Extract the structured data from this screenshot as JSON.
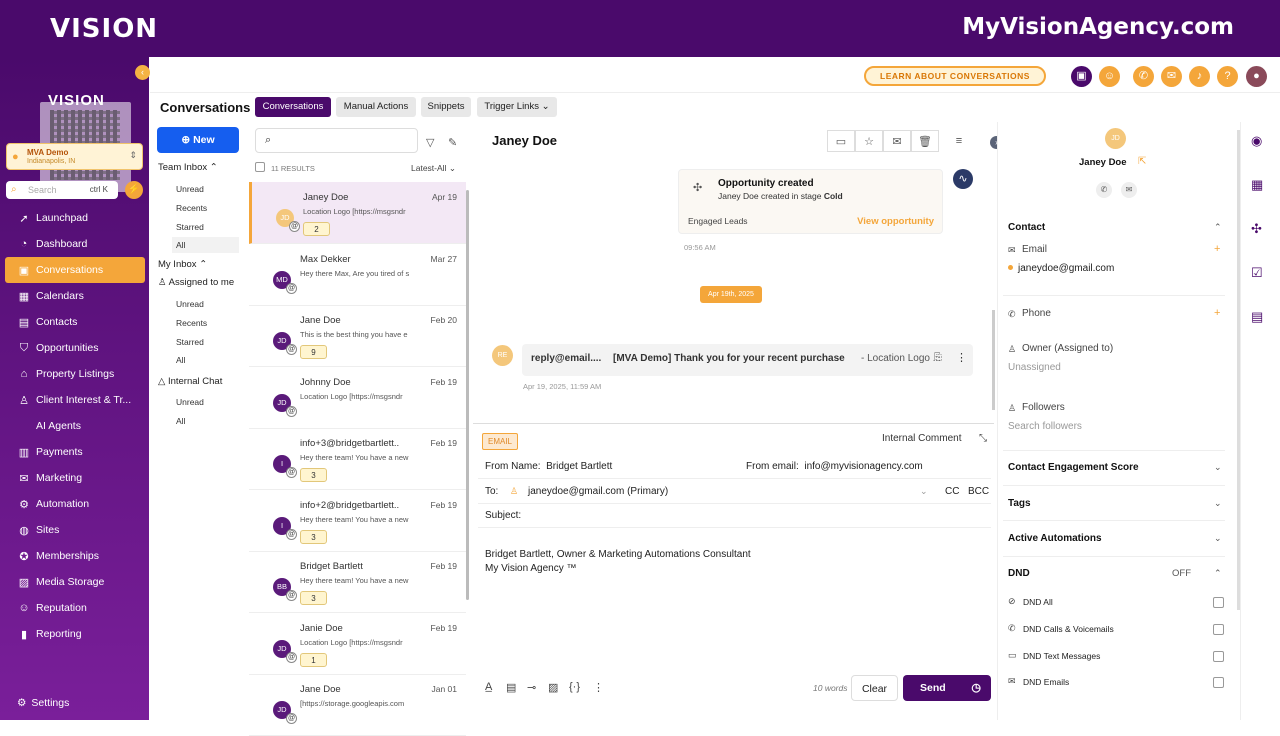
{
  "brand": {
    "left": "VISION",
    "right": "MyVisionAgency.com",
    "qr_text": "VISION"
  },
  "location": {
    "name": "MVA Demo",
    "sub": "Indianapolis, IN"
  },
  "sidebar_search": {
    "placeholder": "Search",
    "shortcut": "ctrl K"
  },
  "nav": [
    {
      "label": "Launchpad",
      "icon": "rocket-icon"
    },
    {
      "label": "Dashboard",
      "icon": "dashboard-icon"
    },
    {
      "label": "Conversations",
      "icon": "chat-icon",
      "active": true
    },
    {
      "label": "Calendars",
      "icon": "calendar-icon"
    },
    {
      "label": "Contacts",
      "icon": "contacts-icon"
    },
    {
      "label": "Opportunities",
      "icon": "funnel-icon"
    },
    {
      "label": "Property Listings",
      "icon": "house-icon"
    },
    {
      "label": "Client Interest & Tr...",
      "icon": "person-icon"
    },
    {
      "label": "AI Agents",
      "icon": ""
    },
    {
      "label": "Payments",
      "icon": "payments-icon"
    },
    {
      "label": "Marketing",
      "icon": "megaphone-icon"
    },
    {
      "label": "Automation",
      "icon": "automation-icon"
    },
    {
      "label": "Sites",
      "icon": "globe-icon"
    },
    {
      "label": "Memberships",
      "icon": "memberships-icon"
    },
    {
      "label": "Media Storage",
      "icon": "image-icon"
    },
    {
      "label": "Reputation",
      "icon": "reputation-icon"
    },
    {
      "label": "Reporting",
      "icon": "bar-chart-icon"
    }
  ],
  "settings_label": "Settings",
  "header": {
    "learn_label": "LEARN ABOUT CONVERSATIONS",
    "title": "Conversations",
    "tabs": [
      "Conversations",
      "Manual Actions",
      "Snippets",
      "Trigger Links"
    ]
  },
  "left_panel": {
    "new_label": "New",
    "team_inbox": "Team Inbox",
    "team_items": [
      "Unread",
      "Recents",
      "Starred",
      "All"
    ],
    "my_inbox": "My Inbox",
    "assigned": "Assigned to me",
    "my_items": [
      "Unread",
      "Recents",
      "Starred",
      "All"
    ],
    "internal_chat": "Internal Chat",
    "chat_items": [
      "Unread",
      "All"
    ]
  },
  "list": {
    "results": "11 RESULTS",
    "sort": "Latest-All",
    "rows": [
      {
        "initials": "JD",
        "name": "Janey Doe",
        "date": "Apr 19",
        "preview": "Location Logo [https://msgsndr",
        "badge": "2",
        "color": "#f4c77b"
      },
      {
        "initials": "MD",
        "name": "Max Dekker",
        "date": "Mar 27",
        "preview": "Hey there Max, Are you tired of s",
        "badge": "",
        "color": "#5a1a7a"
      },
      {
        "initials": "JD",
        "name": "Jane Doe",
        "date": "Feb 20",
        "preview": "This is the best thing you have e",
        "badge": "9",
        "color": "#5a1a7a"
      },
      {
        "initials": "JD",
        "name": "Johnny Doe",
        "date": "Feb 19",
        "preview": "Location Logo [https://msgsndr",
        "badge": "",
        "color": "#5a1a7a"
      },
      {
        "initials": "I",
        "name": "info+3@bridgetbartlett..",
        "date": "Feb 19",
        "preview": "Hey there team! You have a new",
        "badge": "3",
        "color": "#5a1a7a"
      },
      {
        "initials": "I",
        "name": "info+2@bridgetbartlett..",
        "date": "Feb 19",
        "preview": "Hey there team! You have a new",
        "badge": "3",
        "color": "#5a1a7a"
      },
      {
        "initials": "BB",
        "name": "Bridget Bartlett",
        "date": "Feb 19",
        "preview": "Hey there team! You have a new",
        "badge": "3",
        "color": "#5a1a7a"
      },
      {
        "initials": "JD",
        "name": "Janie Doe",
        "date": "Feb 19",
        "preview": "Location Logo [https://msgsndr",
        "badge": "1",
        "color": "#5a1a7a"
      },
      {
        "initials": "JD",
        "name": "Jane Doe",
        "date": "Jan 01",
        "preview": "[https://storage.googleapis.com",
        "badge": "",
        "color": "#5a1a7a"
      }
    ]
  },
  "conversation": {
    "name": "Janey Doe",
    "opp_title": "Opportunity created",
    "opp_sub_prefix": "Janey Doe created in stage ",
    "opp_stage": "Cold",
    "opp_lead": "Engaged Leads",
    "opp_link": "View opportunity",
    "time1": "09:56 AM",
    "date_pill": "Apr 19th, 2025",
    "email_avatar": "RE",
    "email_from": "reply@email....",
    "email_subject": "[MVA Demo] Thank you for your recent purchase",
    "email_snippet": "-  Location Logo ...",
    "time2": "Apr 19, 2025, 11:59 AM"
  },
  "composer": {
    "channel": "EMAIL",
    "internal_comment": "Internal Comment",
    "from_name_label": "From Name:",
    "from_name": "Bridget Bartlett",
    "from_email_label": "From email:",
    "from_email": "info@myvisionagency.com",
    "to_label": "To:",
    "to_value": "janeydoe@gmail.com (Primary)",
    "cc": "CC",
    "bcc": "BCC",
    "subject_label": "Subject:",
    "body_line1": "Bridget Bartlett, Owner & Marketing Automations Consultant",
    "body_line2": "My Vision Agency ™",
    "words": "10 words",
    "clear": "Clear",
    "send": "Send"
  },
  "contact_panel": {
    "avatar": "JD",
    "name": "Janey Doe",
    "contact": "Contact",
    "email_label": "Email",
    "email": "janeydoe@gmail.com",
    "phone_label": "Phone",
    "owner_label": "Owner (Assigned to)",
    "owner_value": "Unassigned",
    "followers_label": "Followers",
    "followers_ph": "Search followers",
    "engagement": "Contact Engagement Score",
    "tags": "Tags",
    "automations": "Active Automations",
    "dnd": "DND",
    "dnd_state": "OFF",
    "dnd_items": [
      "DND All",
      "DND Calls & Voicemails",
      "DND Text Messages",
      "DND Emails"
    ]
  }
}
